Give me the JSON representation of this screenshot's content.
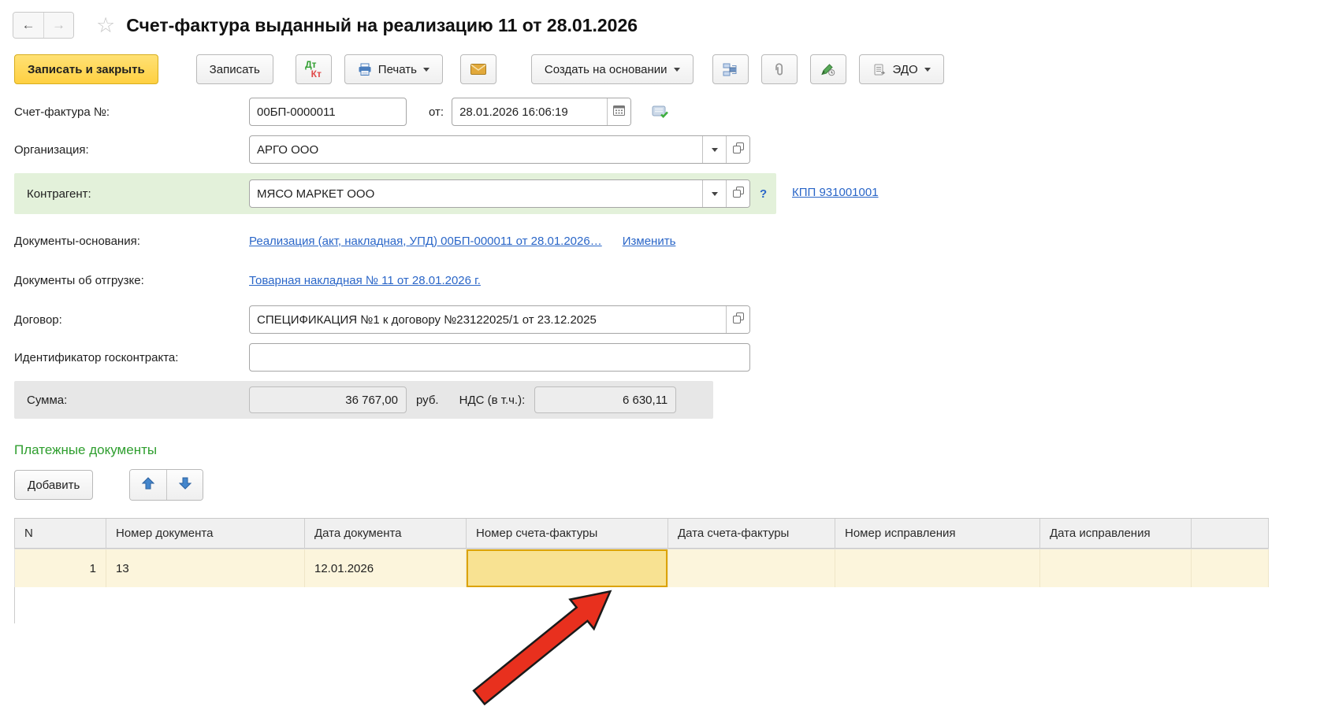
{
  "window": {
    "title": "Счет-фактура выданный на реализацию 11 от 28.01.2026"
  },
  "toolbar": {
    "save_close": "Записать и закрыть",
    "save": "Записать",
    "dt": "Дт",
    "kt": "Кт",
    "print": "Печать",
    "create_based_on": "Создать на основании",
    "edo": "ЭДО"
  },
  "fields": {
    "invoice_number": {
      "label": "Счет-фактура №:",
      "value": "00БП-0000011"
    },
    "date": {
      "label": "от:",
      "value": "28.01.2026 16:06:19"
    },
    "organization": {
      "label": "Организация:",
      "value": "АРГО ООО"
    },
    "counterparty": {
      "label": "Контрагент:",
      "value": "МЯСО МАРКЕТ ООО",
      "help": "?",
      "kpp_link": "КПП 931001001"
    },
    "base_documents": {
      "label": "Документы-основания:",
      "link": "Реализация (акт, накладная, УПД) 00БП-000011 от 28.01.2026…",
      "edit_link": "Изменить"
    },
    "shipping_documents": {
      "label": "Документы об отгрузке:",
      "link": "Товарная накладная № 11 от 28.01.2026 г."
    },
    "contract": {
      "label": "Договор:",
      "value": "СПЕЦИФИКАЦИЯ №1 к договору №23122025/1 от 23.12.2025"
    },
    "gov_contract": {
      "label": "Идентификатор госконтракта:",
      "value": ""
    },
    "sum": {
      "label": "Сумма:",
      "value": "36 767,00",
      "currency": "руб.",
      "vat_label": "НДС (в т.ч.):",
      "vat_value": "6 630,11"
    }
  },
  "payment_documents": {
    "heading": "Платежные документы",
    "add_button": "Добавить",
    "table": {
      "headers": [
        "N",
        "Номер документа",
        "Дата документа",
        "Номер счета-фактуры",
        "Дата счета-фактуры",
        "Номер исправления",
        "Дата исправления",
        ""
      ],
      "rows": [
        {
          "n": "1",
          "doc_number": "13",
          "doc_date": "12.01.2026",
          "invoice_number": "",
          "invoice_date": "",
          "correction_number": "",
          "correction_date": ""
        }
      ]
    }
  },
  "icons": {
    "back": "left-arrow",
    "forward": "right-arrow",
    "favorite": "star-outline",
    "dtkt": "debit-credit",
    "print": "printer",
    "mail": "envelope",
    "structure": "related-documents",
    "attach": "paperclip",
    "sign": "pen-clock",
    "edo": "document-exchange",
    "calendar": "calendar",
    "post": "document-check",
    "dropdown": "chevron-down",
    "open": "open-form",
    "move_up": "blue-arrow-up",
    "move_down": "blue-arrow-down",
    "pointer": "red-arrow"
  },
  "colors": {
    "primary_button_bg": "#FFD042",
    "row_highlight_green": "#E3F1DA",
    "table_row_bg": "#FCF5DC",
    "selected_cell_bg": "#F8E292",
    "selected_cell_border": "#DCA300",
    "link": "#2A66C8",
    "section_heading": "#2E9E2E",
    "arrow_red": "#E8301E"
  }
}
